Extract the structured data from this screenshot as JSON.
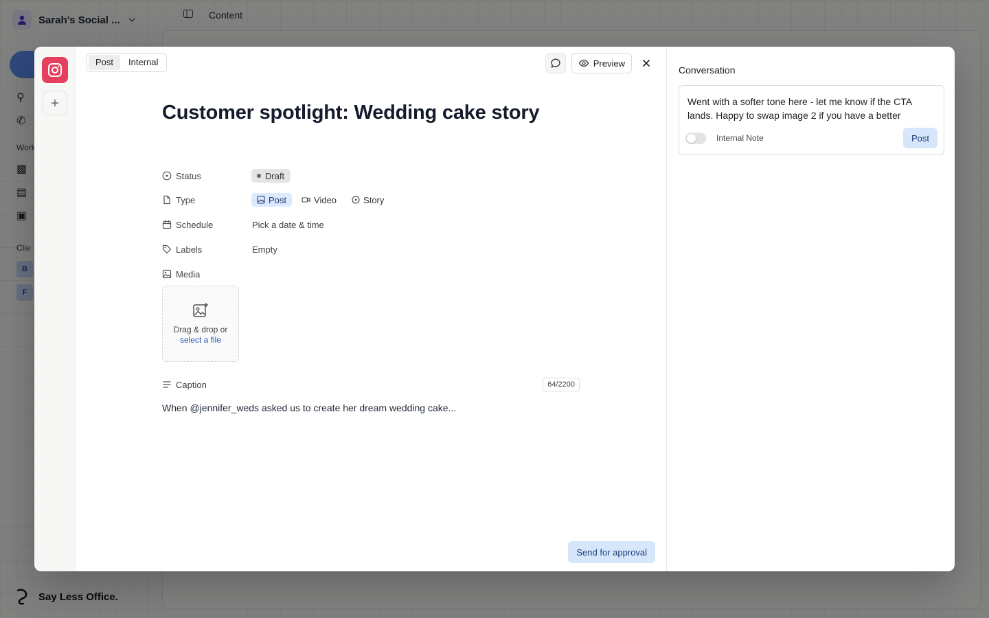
{
  "background": {
    "workspace_name": "Sarah's Social ...",
    "breadcrumb": "Content",
    "sections": [
      "Work",
      "Clie"
    ],
    "client_chips": [
      "B",
      "F"
    ],
    "footer_brand": "Say Less Office."
  },
  "modal": {
    "channel_icon": "instagram-icon",
    "tabs": [
      {
        "label": "Post",
        "active": true
      },
      {
        "label": "Internal",
        "active": false
      }
    ],
    "preview_label": "Preview",
    "title": "Customer spotlight: Wedding cake story",
    "properties": {
      "status": {
        "label": "Status",
        "value": "Draft"
      },
      "type": {
        "label": "Type",
        "options": [
          {
            "label": "Post",
            "active": true
          },
          {
            "label": "Video",
            "active": false
          },
          {
            "label": "Story",
            "active": false
          }
        ]
      },
      "schedule": {
        "label": "Schedule",
        "value": "Pick a date & time"
      },
      "labels": {
        "label": "Labels",
        "value": "Empty"
      },
      "media": {
        "label": "Media"
      }
    },
    "media_drop": {
      "text": "Drag & drop or",
      "link": "select a file"
    },
    "caption": {
      "label": "Caption",
      "counter": "64/2200",
      "text": "When @jennifer_weds asked us to create her dream wedding cake..."
    },
    "send_label": "Send for approval"
  },
  "conversation": {
    "title": "Conversation",
    "draft_text": "Went with a softer tone here - let me know if the CTA lands. Happy to swap image 2 if you have a better",
    "internal_note_label": "Internal Note",
    "internal_note_on": false,
    "post_label": "Post"
  },
  "colors": {
    "instagram": "#e4405f",
    "primary_soft": "#d6e6fb",
    "primary_text": "#1a3d78"
  }
}
